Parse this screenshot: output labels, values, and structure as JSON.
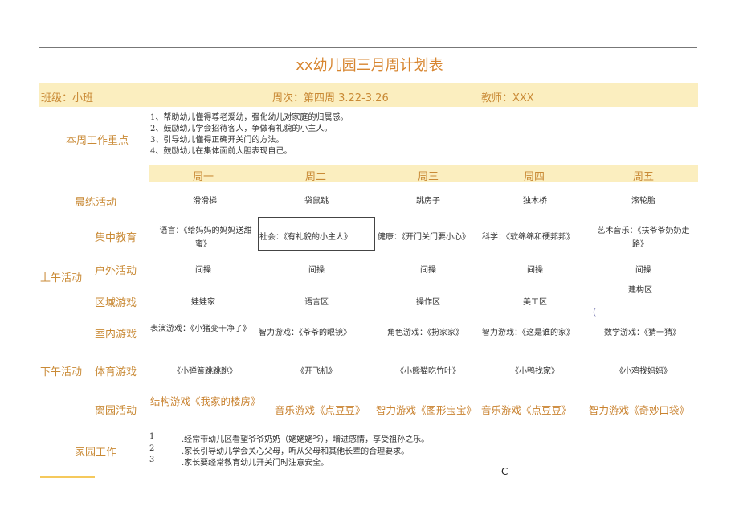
{
  "title": "xx幼儿园三月周计划表",
  "header": {
    "class": "班级：小班",
    "week": "周次：第四周 3.22-3.26",
    "teacher": "教师：XXX"
  },
  "focus": {
    "label": "本周工作重点",
    "items": [
      "1、帮助幼儿懂得尊老爱幼，强化幼儿对家庭的归属感。",
      "2、鼓励幼儿学会招待客人，争做有礼貌的小主人。",
      "3、引导幼儿懂得正确开关门的方法。",
      "4、鼓励幼儿在集体面前大胆表现自己。"
    ]
  },
  "days": [
    "周一",
    "周二",
    "周三",
    "周四",
    "周五"
  ],
  "sections": {
    "morning": "上午活动",
    "afternoon": "下午活动"
  },
  "rows": {
    "morning_exercise": {
      "label": "晨练活动",
      "cells": [
        "滑滑梯",
        "袋鼠跳",
        "跳房子",
        "独木桥",
        "滚轮胎"
      ]
    },
    "group_teaching": {
      "label": "集中教育",
      "cells": [
        "语言：《给妈妈的妈妈送甜",
        "蜜》",
        "社会：《有礼貌的小主人》",
        "健康：《开门关门要小心》",
        "科学：《软绵绵和硬邦邦》",
        "艺术音乐：《扶爷爷奶奶走",
        "路》"
      ]
    },
    "outdoor": {
      "label": "户外活动",
      "cells": [
        "间操",
        "间操",
        "间操",
        "间操",
        "间操"
      ]
    },
    "area_games": {
      "label": "区域游戏",
      "cells": [
        "娃娃家",
        "语言区",
        "操作区",
        "美工区",
        "建构区"
      ]
    },
    "indoor_games": {
      "label": "室内游戏",
      "cells": [
        "表演游戏：《小猪变干净了》",
        "智力游戏：《爷爷的眼镜》",
        "角色游戏：《扮家家》",
        "智力游戏：《这是谁的家》",
        "数学游戏：《猜一猜》"
      ]
    },
    "pe_games": {
      "label": "体育游戏",
      "cells": [
        "《小弹簧跳跳跳》",
        "《开飞机》",
        "《小熊猫吃竹叶》",
        "《小鸭找家》",
        "《小鸡找妈妈》"
      ]
    },
    "leaving": {
      "label": "离园活动",
      "cells": [
        "结构游戏《我家的楼房》",
        "音乐游戏《点豆豆》",
        "智力游戏《图形宝宝》",
        "音乐游戏《点豆豆》",
        "智力游戏《奇妙口袋》"
      ]
    }
  },
  "home": {
    "label": "家园工作",
    "items": [
      {
        "num": "1",
        "text": ".经常带幼儿区看望爷爷奶奶（姥姥姥爷），增进感情，享受祖孙之乐。"
      },
      {
        "num": "2",
        "text": ".家长引导幼儿学会关心父母，听从父母和其他长辈的合理要求。"
      },
      {
        "num": "3",
        "text": ".家长要经常教育幼儿开关门时注意安全。"
      }
    ]
  },
  "stray_marks": {
    "paren": "(",
    "c": "C"
  },
  "colors": {
    "title": "#d7852f",
    "label": "#c98a36",
    "band": "#fbeebf",
    "bottom_bar": "#f5c95c"
  }
}
